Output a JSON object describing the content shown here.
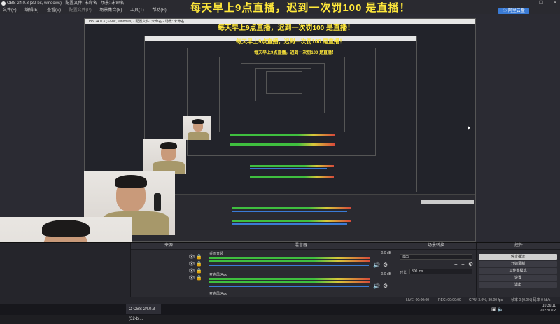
{
  "window": {
    "title": "OBS 24.0.3 (32-bit, windows) - 配置文件: 未命名 - 场景: 未命名",
    "controls": [
      "—",
      "☐",
      "✕"
    ]
  },
  "menu": [
    "文件(F)",
    "编辑(E)",
    "查看(V)",
    "配置文件(P)",
    "场景集合(S)",
    "工具(T)",
    "帮助(H)"
  ],
  "banner": "每天早上9点直播，迟到一次罚100 是直播！",
  "nested_banner": "每天早上9点直播，迟到一次罚100 是直播！",
  "cloud_button": "阿里云盘",
  "docks": {
    "sources": {
      "header": "来源"
    },
    "mixer": {
      "header": "混音器",
      "tracks": [
        {
          "name": "桌面音频",
          "value": "0.0 dB"
        },
        {
          "name": "麦克风/Aux",
          "value": "0.0 dB"
        }
      ],
      "partial_label": "麦克风/Aux"
    },
    "transitions": {
      "header": "场景转换",
      "type": "淡出",
      "duration_label": "时长",
      "duration_value": "300 ms"
    },
    "controls": {
      "header": "控件",
      "buttons": [
        "停止推流",
        "开始录制",
        "工作室模式",
        "设置",
        "退出"
      ]
    }
  },
  "status": {
    "live": "LIVE: 00:00:00",
    "rec": "REC: 00:00:00",
    "cpu": "CPU: 3.0%, 30.00 fps",
    "right": "帧率 0 (0.0%) 码率 0 kb/s"
  },
  "taskbar": {
    "app_button": "O OBS 24.0.3 (32-bi...",
    "time": "10:36:11",
    "date": "2022/1/12"
  },
  "icons": [
    "obs-logo-icon",
    "eye-icon",
    "lock-icon",
    "speaker-icon",
    "gear-icon",
    "plus-icon",
    "minus-icon",
    "cloud-icon",
    "network-icon",
    "volume-icon"
  ]
}
